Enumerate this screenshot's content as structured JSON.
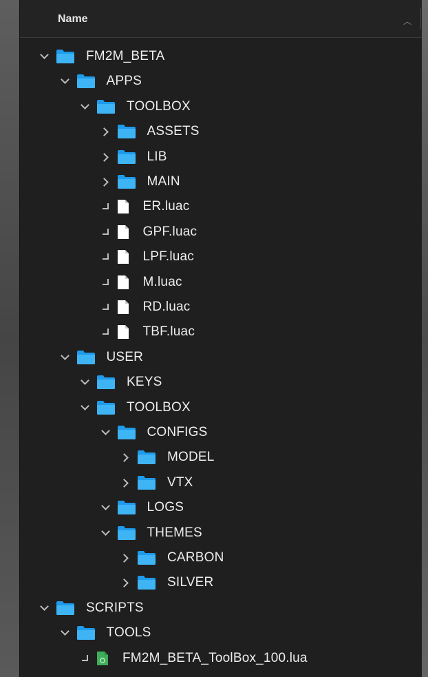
{
  "header": {
    "column_title": "Name"
  },
  "tree": [
    {
      "label": "FM2M_BETA",
      "kind": "folder",
      "state": "open",
      "depth": 0
    },
    {
      "label": "APPS",
      "kind": "folder",
      "state": "open",
      "depth": 1
    },
    {
      "label": "TOOLBOX",
      "kind": "folder",
      "state": "open",
      "depth": 2
    },
    {
      "label": "ASSETS",
      "kind": "folder",
      "state": "closed",
      "depth": 3
    },
    {
      "label": "LIB",
      "kind": "folder",
      "state": "closed",
      "depth": 3
    },
    {
      "label": "MAIN",
      "kind": "folder",
      "state": "closed",
      "depth": 3
    },
    {
      "label": "ER.luac",
      "kind": "file",
      "depth": 3
    },
    {
      "label": "GPF.luac",
      "kind": "file",
      "depth": 3
    },
    {
      "label": "LPF.luac",
      "kind": "file",
      "depth": 3
    },
    {
      "label": "M.luac",
      "kind": "file",
      "depth": 3
    },
    {
      "label": "RD.luac",
      "kind": "file",
      "depth": 3
    },
    {
      "label": "TBF.luac",
      "kind": "file",
      "depth": 3
    },
    {
      "label": "USER",
      "kind": "folder",
      "state": "open",
      "depth": 1
    },
    {
      "label": "KEYS",
      "kind": "folder",
      "state": "open",
      "depth": 2
    },
    {
      "label": "TOOLBOX",
      "kind": "folder",
      "state": "open",
      "depth": 2
    },
    {
      "label": "CONFIGS",
      "kind": "folder",
      "state": "open",
      "depth": 3
    },
    {
      "label": "MODEL",
      "kind": "folder",
      "state": "closed",
      "depth": 4
    },
    {
      "label": "VTX",
      "kind": "folder",
      "state": "closed",
      "depth": 4
    },
    {
      "label": "LOGS",
      "kind": "folder",
      "state": "open",
      "depth": 3
    },
    {
      "label": "THEMES",
      "kind": "folder",
      "state": "open",
      "depth": 3
    },
    {
      "label": "CARBON",
      "kind": "folder",
      "state": "closed",
      "depth": 4
    },
    {
      "label": "SILVER",
      "kind": "folder",
      "state": "closed",
      "depth": 4
    },
    {
      "label": "SCRIPTS",
      "kind": "folder",
      "state": "open",
      "depth": 0
    },
    {
      "label": "TOOLS",
      "kind": "folder",
      "state": "open",
      "depth": 1
    },
    {
      "label": "FM2M_BETA_ToolBox_100.lua",
      "kind": "lua-file",
      "depth": 2
    }
  ],
  "colors": {
    "folder_accent": "#1e9bea",
    "folder_body": "#3eb4f5",
    "file": "#ffffff",
    "lua_file": "#3fae5a",
    "text": "#ededed",
    "background": "#1f1f1f"
  },
  "icons": {
    "folder": "folder-icon",
    "file": "file-icon",
    "lua-file": "lua-file-icon",
    "expanded": "chevron-down-icon",
    "collapsed": "chevron-right-icon",
    "sort": "sort-ascending-icon"
  }
}
